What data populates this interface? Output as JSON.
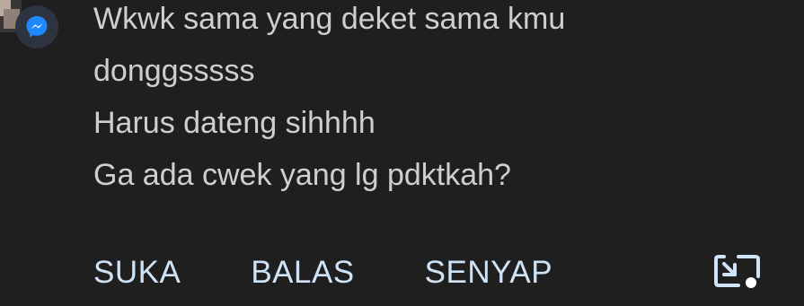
{
  "notification": {
    "app_icon": "messenger-icon",
    "message_lines": [
      "Wkwk sama yang deket sama kmu",
      "donggsssss",
      "Harus dateng sihhhh",
      "Ga ada cwek yang lg pdktkah?"
    ],
    "actions": {
      "like_label": "SUKA",
      "reply_label": "BALAS",
      "mute_label": "SENYAP"
    },
    "pip_icon": "picture-in-picture-icon"
  },
  "colors": {
    "background": "#201f1f",
    "text": "#cfcfcf",
    "action_text": "#cfe3f7",
    "badge_bg": "#2e3340",
    "messenger_blue": "#1e88ff"
  }
}
